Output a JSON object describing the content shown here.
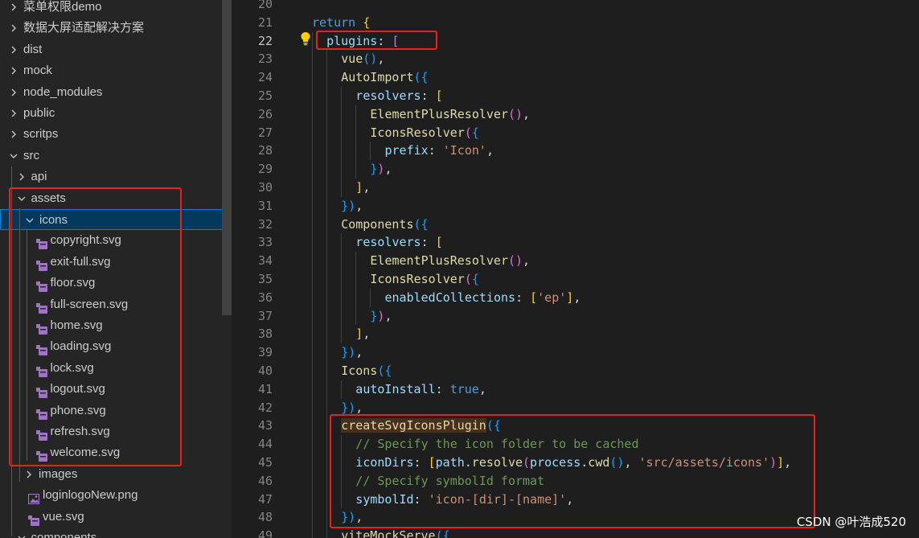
{
  "explorer": {
    "items": [
      {
        "label": "菜单权限demo",
        "depth": 0,
        "kind": "folder",
        "state": "collapsed"
      },
      {
        "label": "数据大屏适配解决方案",
        "depth": 0,
        "kind": "folder",
        "state": "collapsed"
      },
      {
        "label": "dist",
        "depth": 0,
        "kind": "folder",
        "state": "collapsed"
      },
      {
        "label": "mock",
        "depth": 0,
        "kind": "folder",
        "state": "collapsed"
      },
      {
        "label": "node_modules",
        "depth": 0,
        "kind": "folder",
        "state": "collapsed"
      },
      {
        "label": "public",
        "depth": 0,
        "kind": "folder",
        "state": "collapsed"
      },
      {
        "label": "scritps",
        "depth": 0,
        "kind": "folder",
        "state": "collapsed"
      },
      {
        "label": "src",
        "depth": 0,
        "kind": "folder",
        "state": "expanded"
      },
      {
        "label": "api",
        "depth": 1,
        "kind": "folder",
        "state": "collapsed"
      },
      {
        "label": "assets",
        "depth": 1,
        "kind": "folder",
        "state": "expanded"
      },
      {
        "label": "icons",
        "depth": 2,
        "kind": "folder",
        "state": "expanded",
        "selected": true
      },
      {
        "label": "copyright.svg",
        "depth": 3,
        "kind": "svg"
      },
      {
        "label": "exit-full.svg",
        "depth": 3,
        "kind": "svg"
      },
      {
        "label": "floor.svg",
        "depth": 3,
        "kind": "svg"
      },
      {
        "label": "full-screen.svg",
        "depth": 3,
        "kind": "svg"
      },
      {
        "label": "home.svg",
        "depth": 3,
        "kind": "svg"
      },
      {
        "label": "loading.svg",
        "depth": 3,
        "kind": "svg"
      },
      {
        "label": "lock.svg",
        "depth": 3,
        "kind": "svg"
      },
      {
        "label": "logout.svg",
        "depth": 3,
        "kind": "svg"
      },
      {
        "label": "phone.svg",
        "depth": 3,
        "kind": "svg"
      },
      {
        "label": "refresh.svg",
        "depth": 3,
        "kind": "svg"
      },
      {
        "label": "welcome.svg",
        "depth": 3,
        "kind": "svg"
      },
      {
        "label": "images",
        "depth": 2,
        "kind": "folder",
        "state": "collapsed"
      },
      {
        "label": "loginlogoNew.png",
        "depth": 2,
        "kind": "png"
      },
      {
        "label": "vue.svg",
        "depth": 2,
        "kind": "svg"
      },
      {
        "label": "components",
        "depth": 1,
        "kind": "folder",
        "state": "expanded"
      }
    ]
  },
  "editor": {
    "active_line": 22,
    "lines": [
      {
        "n": 20,
        "indent": 0,
        "tokens": []
      },
      {
        "n": 21,
        "indent": 0,
        "tokens": [
          [
            "kw",
            "return"
          ],
          [
            "pl",
            " "
          ],
          [
            "b1",
            "{"
          ]
        ]
      },
      {
        "n": 22,
        "indent": 1,
        "tokens": [
          [
            "prop",
            "plugins"
          ],
          [
            "pl",
            ": "
          ],
          [
            "b2",
            "["
          ]
        ]
      },
      {
        "n": 23,
        "indent": 2,
        "tokens": [
          [
            "fn",
            "vue"
          ],
          [
            "b3",
            "()"
          ],
          [
            "pl",
            ","
          ]
        ]
      },
      {
        "n": 24,
        "indent": 2,
        "tokens": [
          [
            "fn",
            "AutoImport"
          ],
          [
            "b3",
            "({"
          ]
        ]
      },
      {
        "n": 25,
        "indent": 3,
        "tokens": [
          [
            "prop",
            "resolvers"
          ],
          [
            "pl",
            ": "
          ],
          [
            "b1",
            "["
          ]
        ]
      },
      {
        "n": 26,
        "indent": 4,
        "tokens": [
          [
            "fn",
            "ElementPlusResolver"
          ],
          [
            "b2",
            "()"
          ],
          [
            "pl",
            ","
          ]
        ]
      },
      {
        "n": 27,
        "indent": 4,
        "tokens": [
          [
            "fn",
            "IconsResolver"
          ],
          [
            "b2",
            "("
          ],
          [
            "b3",
            "{"
          ]
        ]
      },
      {
        "n": 28,
        "indent": 5,
        "tokens": [
          [
            "prop",
            "prefix"
          ],
          [
            "pl",
            ": "
          ],
          [
            "str",
            "'Icon'"
          ],
          [
            "pl",
            ","
          ]
        ]
      },
      {
        "n": 29,
        "indent": 4,
        "tokens": [
          [
            "b3",
            "}"
          ],
          [
            "b2",
            ")"
          ],
          [
            "pl",
            ","
          ]
        ]
      },
      {
        "n": 30,
        "indent": 3,
        "tokens": [
          [
            "b1",
            "]"
          ],
          [
            "pl",
            ","
          ]
        ]
      },
      {
        "n": 31,
        "indent": 2,
        "tokens": [
          [
            "b3",
            "})"
          ],
          [
            "pl",
            ","
          ]
        ]
      },
      {
        "n": 32,
        "indent": 2,
        "tokens": [
          [
            "fn",
            "Components"
          ],
          [
            "b3",
            "({"
          ]
        ]
      },
      {
        "n": 33,
        "indent": 3,
        "tokens": [
          [
            "prop",
            "resolvers"
          ],
          [
            "pl",
            ": "
          ],
          [
            "b1",
            "["
          ]
        ]
      },
      {
        "n": 34,
        "indent": 4,
        "tokens": [
          [
            "fn",
            "ElementPlusResolver"
          ],
          [
            "b2",
            "()"
          ],
          [
            "pl",
            ","
          ]
        ]
      },
      {
        "n": 35,
        "indent": 4,
        "tokens": [
          [
            "fn",
            "IconsResolver"
          ],
          [
            "b2",
            "("
          ],
          [
            "b3",
            "{"
          ]
        ]
      },
      {
        "n": 36,
        "indent": 5,
        "tokens": [
          [
            "prop",
            "enabledCollections"
          ],
          [
            "pl",
            ": "
          ],
          [
            "b1",
            "["
          ],
          [
            "str",
            "'ep'"
          ],
          [
            "b1",
            "]"
          ],
          [
            "pl",
            ","
          ]
        ]
      },
      {
        "n": 37,
        "indent": 4,
        "tokens": [
          [
            "b3",
            "}"
          ],
          [
            "b2",
            ")"
          ],
          [
            "pl",
            ","
          ]
        ]
      },
      {
        "n": 38,
        "indent": 3,
        "tokens": [
          [
            "b1",
            "]"
          ],
          [
            "pl",
            ","
          ]
        ]
      },
      {
        "n": 39,
        "indent": 2,
        "tokens": [
          [
            "b3",
            "})"
          ],
          [
            "pl",
            ","
          ]
        ]
      },
      {
        "n": 40,
        "indent": 2,
        "tokens": [
          [
            "fn",
            "Icons"
          ],
          [
            "b3",
            "({"
          ]
        ]
      },
      {
        "n": 41,
        "indent": 3,
        "tokens": [
          [
            "prop",
            "autoInstall"
          ],
          [
            "pl",
            ": "
          ],
          [
            "kw",
            "true"
          ],
          [
            "pl",
            ","
          ]
        ]
      },
      {
        "n": 42,
        "indent": 2,
        "tokens": [
          [
            "b3",
            "})"
          ],
          [
            "pl",
            ","
          ]
        ]
      },
      {
        "n": 43,
        "indent": 2,
        "tokens": [
          [
            "fn hl-bg",
            "createSvgIconsPlugin"
          ],
          [
            "b3",
            "({"
          ]
        ]
      },
      {
        "n": 44,
        "indent": 3,
        "tokens": [
          [
            "cm",
            "// Specify the icon folder to be cached"
          ]
        ]
      },
      {
        "n": 45,
        "indent": 3,
        "tokens": [
          [
            "prop",
            "iconDirs"
          ],
          [
            "pl",
            ": "
          ],
          [
            "b1",
            "["
          ],
          [
            "prop",
            "path"
          ],
          [
            "pl",
            "."
          ],
          [
            "fn",
            "resolve"
          ],
          [
            "b2",
            "("
          ],
          [
            "prop",
            "process"
          ],
          [
            "pl",
            "."
          ],
          [
            "fn",
            "cwd"
          ],
          [
            "b3",
            "()"
          ],
          [
            "pl",
            ", "
          ],
          [
            "str",
            "'src/assets/icons'"
          ],
          [
            "b2",
            ")"
          ],
          [
            "b1",
            "]"
          ],
          [
            "pl",
            ","
          ]
        ]
      },
      {
        "n": 46,
        "indent": 3,
        "tokens": [
          [
            "cm",
            "// Specify symbolId format"
          ]
        ]
      },
      {
        "n": 47,
        "indent": 3,
        "tokens": [
          [
            "prop",
            "symbolId"
          ],
          [
            "pl",
            ": "
          ],
          [
            "str",
            "'icon-[dir]-[name]'"
          ],
          [
            "pl",
            ","
          ]
        ]
      },
      {
        "n": 48,
        "indent": 2,
        "tokens": [
          [
            "b3",
            "})"
          ],
          [
            "pl",
            ","
          ]
        ]
      },
      {
        "n": 49,
        "indent": 2,
        "tokens": [
          [
            "fn",
            "viteMockServe"
          ],
          [
            "b3",
            "({"
          ]
        ]
      }
    ]
  },
  "watermark": "CSDN @叶浩成520",
  "colors": {
    "sidebar_bg": "#252526",
    "editor_bg": "#1e1e1e",
    "selection_bg": "#04395e",
    "annotation_red": "#e8221b",
    "svg_icon": "#a074c4"
  }
}
